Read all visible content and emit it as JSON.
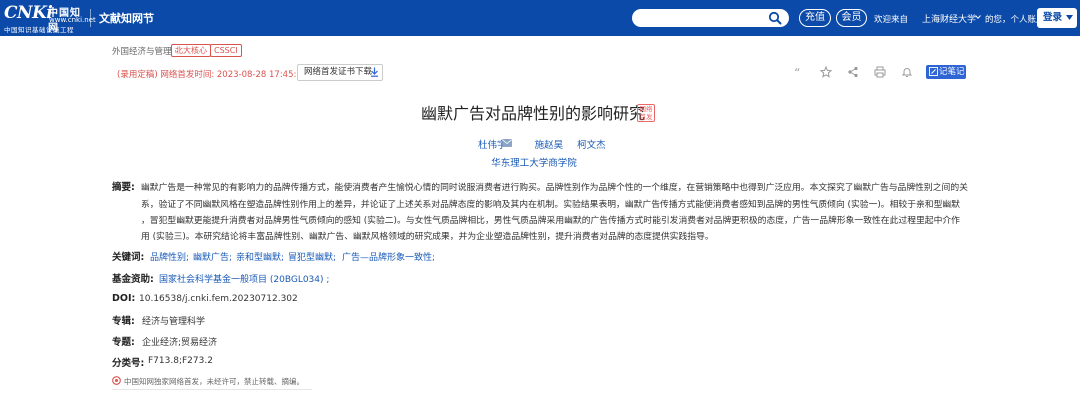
{
  "header": {
    "logo": {
      "big": "CNKi",
      "cn": "中国知网",
      "url": "www.cnki.net",
      "sub": "中国知识基础设施工程"
    },
    "section_title": "文献知网节",
    "search_placeholder": "",
    "recharge_label": "充值",
    "member_label": "会员",
    "welcome": "欢迎来自",
    "org": "上海财经大学",
    "greeting": "的您，个人账户",
    "login_label": "登录",
    "accent": "#0b4aa8"
  },
  "meta": {
    "crumb": "外国经济与管理 ·",
    "tags": [
      "北大核心",
      "CSSCI"
    ],
    "pubtime": "(录用定稿) 网络首发时间: 2023-08-28 17:45:00",
    "cert_button": "网络首发证书下载",
    "tools": [
      "quote-icon",
      "star-icon",
      "share-icon",
      "print-icon",
      "bell-icon"
    ],
    "note_button": "记笔记"
  },
  "article": {
    "title": "幽默广告对品牌性别的影响研究",
    "title_badge": "网络首发",
    "authors": [
      "杜伟宇",
      "施赵昊",
      "柯文杰"
    ],
    "affiliation": "华东理工大学商学院"
  },
  "details": {
    "abstract_label": "摘要:",
    "abstract_lines": [
      "幽默广告是一种常见的有影响力的品牌传播方式，能使消费者产生愉悦心情的同时说服消费者进行购买。品牌性别作为品牌个性的一个维度，在营销策略中也得到广泛应用。本文探究了幽默广告与品牌性别之间的关",
      "系，验证了不同幽默风格在塑造品牌性别作用上的差异，并论证了上述关系对品牌态度的影响及其内在机制。实验结果表明，幽默广告传播方式能使消费者感知到品牌的男性气质倾向 (实验一)。相较于亲和型幽默",
      "，冒犯型幽默更能提升消费者对品牌男性气质倾向的感知 (实验二)。与女性气质品牌相比，男性气质品牌采用幽默的广告传播方式时能引发消费者对品牌更积极的态度，广告一品牌形象一致性在此过程里起中介作",
      "用 (实验三)。本研究结论将丰富品牌性别、幽默广告、幽默风格领域的研究成果，并为企业塑造品牌性别，提升消费者对品牌的态度提供实践指导。"
    ],
    "keywords_label": "关键词:",
    "keywords": [
      "品牌性别;",
      "幽默广告;",
      "亲和型幽默;",
      "冒犯型幽默;",
      "广告—品牌形象一致性;"
    ],
    "fund_label": "基金资助:",
    "fund": "国家社会科学基金一般项目 (20BGL034) ;",
    "doi_label": "DOI:",
    "doi": "10.16538/j.cnki.fem.20230712.302",
    "album_label": "专辑:",
    "album": "经济与管理科学",
    "topic_label": "专题:",
    "topic": "企业经济;贸易经济",
    "class_label": "分类号:",
    "class_code": "F713.8;F273.2",
    "footnote": "中国知网独家网络首发，未经许可，禁止转载、摘编。"
  }
}
